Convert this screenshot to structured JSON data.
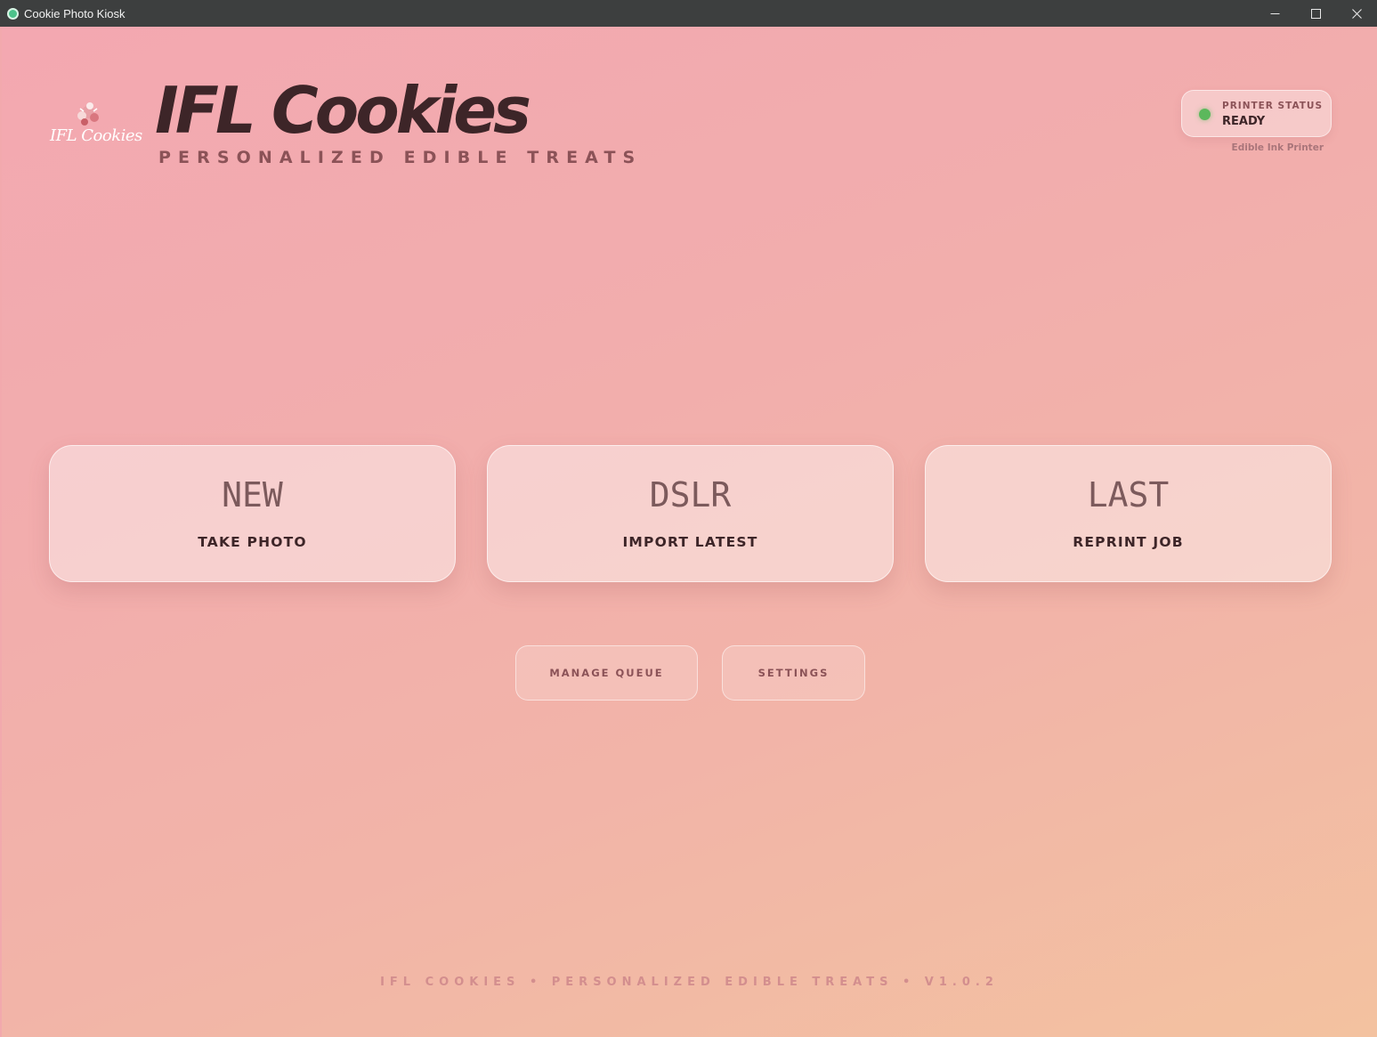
{
  "window": {
    "title": "Cookie Photo Kiosk",
    "controls": [
      "minimize-icon",
      "maximize-icon",
      "close-icon"
    ]
  },
  "header": {
    "logo_text": "IFL Cookies",
    "brand_title": "IFL Cookies",
    "brand_subtitle": "PERSONALIZED EDIBLE TREATS"
  },
  "printer": {
    "label": "PRINTER STATUS",
    "value": "READY",
    "name": "Edible Ink Printer",
    "status_color": "#5cb85c"
  },
  "actions": [
    {
      "big": "NEW",
      "label": "TAKE PHOTO"
    },
    {
      "big": "DSLR",
      "label": "IMPORT LATEST"
    },
    {
      "big": "LAST",
      "label": "REPRINT JOB"
    }
  ],
  "secondary": {
    "manage_queue": "MANAGE QUEUE",
    "settings": "SETTINGS"
  },
  "footer": "IFL COOKIES • PERSONALIZED EDIBLE TREATS • V1.0.2",
  "colors": {
    "text_dark": "#3d2528",
    "text_muted": "#8b5257",
    "titlebar": "#3d3f3f"
  }
}
